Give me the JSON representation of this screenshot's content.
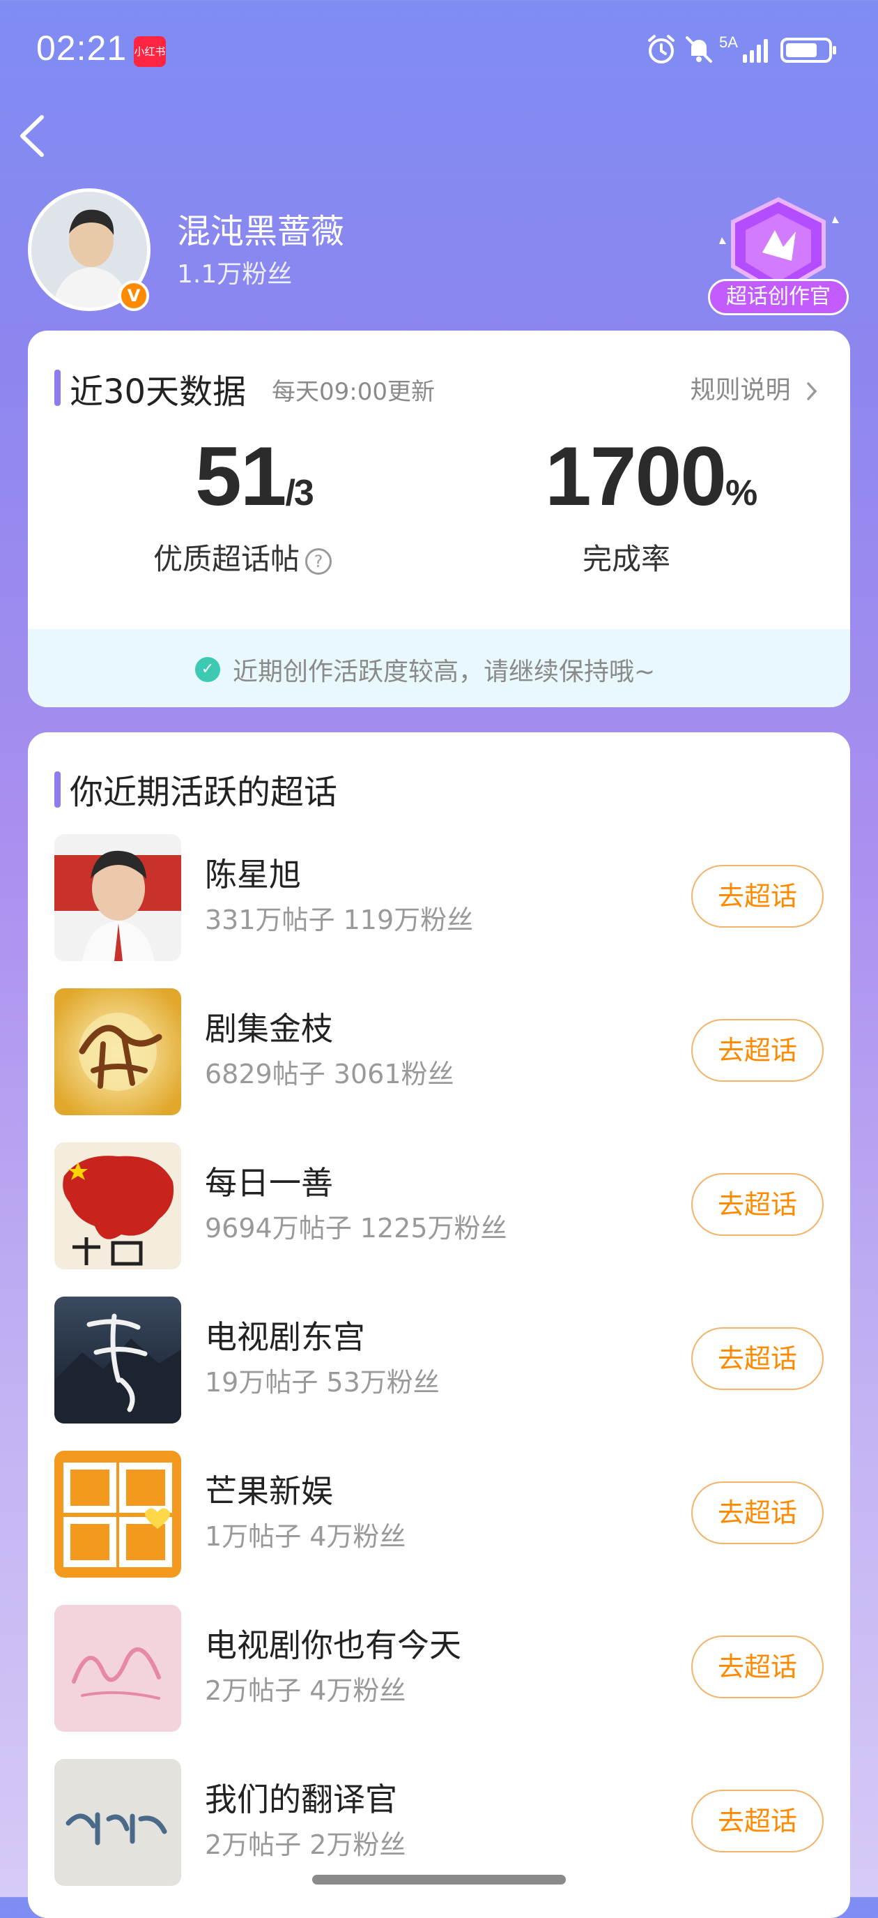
{
  "status_bar": {
    "time": "02:21",
    "app_badge": "小红书",
    "network": "5A",
    "icons": [
      "alarm-icon",
      "mute-icon",
      "signal-icon",
      "battery-icon"
    ]
  },
  "header": {
    "back_icon": "chevron-left-icon",
    "user": {
      "name": "混沌黑蔷薇",
      "fans": "1.1万粉丝",
      "verified": true
    },
    "badge_label": "超话创作官"
  },
  "stats_card": {
    "title": "近30天数据",
    "update_note": "每天09:00更新",
    "rules_label": "规则说明",
    "quality_posts": {
      "value": "51",
      "target": "/3",
      "label": "优质超话帖"
    },
    "completion": {
      "value": "1700",
      "unit": "%",
      "label": "完成率"
    },
    "tip": "近期创作活跃度较高，请继续保持哦~"
  },
  "topics_card": {
    "title": "你近期活跃的超话",
    "button_label": "去超话",
    "items": [
      {
        "name": "陈星旭",
        "stats": "331万帖子 119万粉丝"
      },
      {
        "name": "剧集金枝",
        "stats": "6829帖子 3061粉丝"
      },
      {
        "name": "每日一善",
        "stats": "9694万帖子 1225万粉丝"
      },
      {
        "name": "电视剧东宫",
        "stats": "19万帖子 53万粉丝"
      },
      {
        "name": "芒果新娱",
        "stats": "1万帖子 4万粉丝"
      },
      {
        "name": "电视剧你也有今天",
        "stats": "2万帖子 4万粉丝"
      },
      {
        "name": "我们的翻译官",
        "stats": "2万帖子 2万粉丝"
      }
    ]
  },
  "colors": {
    "accent": "#ff8a00",
    "section_bar": "#8c7cf0",
    "tip_bg": "#e8f8fc",
    "check": "#3ec9b4"
  }
}
